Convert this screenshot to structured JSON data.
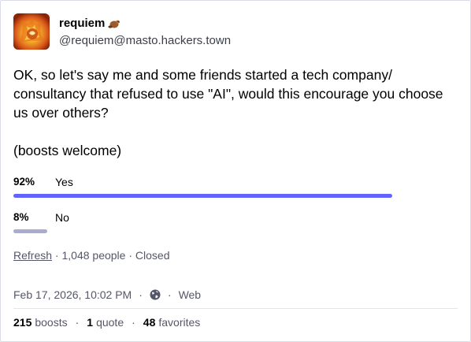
{
  "author": {
    "display_name": "requiem",
    "emoji_icon": "beaver-emoji-icon",
    "handle": "@requiem@masto.hackers.town"
  },
  "post": {
    "paragraph_1": "OK, so let's say me and some friends started a tech company/ consultancy that refused to use \"AI\", would this encourage you choose us over others?",
    "paragraph_2": "(boosts welcome)"
  },
  "poll": {
    "options": [
      {
        "percent": "92%",
        "label": "Yes",
        "fraction": 0.92
      },
      {
        "percent": "8%",
        "label": "No",
        "fraction": 0.08
      }
    ],
    "refresh_label": "Refresh",
    "voters": "1,048 people",
    "status": "Closed",
    "colors": {
      "leading": "#6364ff",
      "trailing": "#a9abcf"
    }
  },
  "meta": {
    "timestamp": "Feb 17, 2026, 10:02 PM",
    "visibility_icon": "globe-icon",
    "application": "Web"
  },
  "stats": {
    "boosts_count": "215",
    "boosts_label": "boosts",
    "quotes_count": "1",
    "quotes_label": "quote",
    "favorites_count": "48",
    "favorites_label": "favorites"
  }
}
